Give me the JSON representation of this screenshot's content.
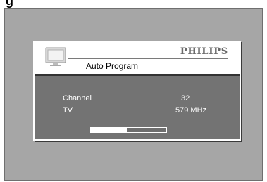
{
  "header": {
    "fragment_text": "g"
  },
  "osd": {
    "brand": "PHILIPS",
    "title": "Auto Program",
    "icon": "tv-icon",
    "rows": [
      {
        "label": "Channel",
        "value": "32"
      },
      {
        "label": "TV",
        "value": "579 MHz"
      }
    ],
    "progress": {
      "fraction": 0.48
    }
  },
  "colors": {
    "screen_bg": "#a6a6a6",
    "osd_body": "#737373",
    "osd_header": "#ffffff",
    "brand_text": "#6a6a6a",
    "progress_fill": "#ffffff"
  }
}
